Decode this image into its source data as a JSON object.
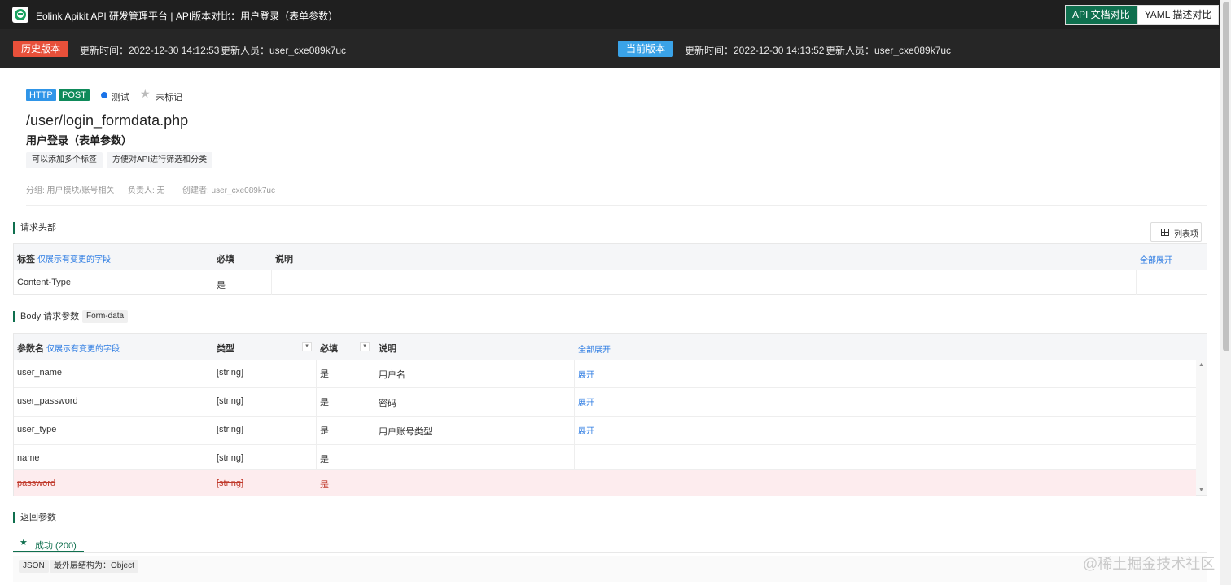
{
  "app": {
    "title": "Eolink Apikit API 研发管理平台 | API版本对比：用户登录（表单参数）",
    "compare_tabs": [
      "API 文档对比",
      "YAML 描述对比"
    ]
  },
  "versions": {
    "history": {
      "label": "历史版本",
      "time": "更新时间：2022-12-30 14:12:53",
      "user": "更新人员：user_cxe089k7uc"
    },
    "current": {
      "label": "当前版本",
      "time": "更新时间：2022-12-30 14:13:52",
      "user": "更新人员：user_cxe089k7uc"
    }
  },
  "api": {
    "protocol": "HTTP",
    "method": "POST",
    "status": "测试",
    "mark": "未标记",
    "path": "/user/login_formdata.php",
    "name": "用户登录（表单参数）",
    "tags": [
      "可以添加多个标签",
      "方便对API进行筛选和分类"
    ],
    "group": "分组: 用户模块/账号相关",
    "owner": "负责人: 无",
    "creator": "创建者: user_cxe089k7uc"
  },
  "headers_section": {
    "title": "请求头部",
    "columns_button": "列表项",
    "col_tag": "标签",
    "only_changed": "仅展示有变更的字段",
    "col_required": "必填",
    "col_desc": "说明",
    "expand_all": "全部展开",
    "rows": [
      {
        "name": "Content-Type",
        "required": "是"
      }
    ]
  },
  "body_section": {
    "title": "Body 请求参数",
    "format": "Form-data",
    "col_name": "参数名",
    "only_changed": "仅展示有变更的字段",
    "col_type": "类型",
    "col_required": "必填",
    "col_desc": "说明",
    "expand_all": "全部展开",
    "rows": [
      {
        "name": "user_name",
        "type": "[string]",
        "required": "是",
        "desc": "用户名",
        "action": "展开"
      },
      {
        "name": "user_password",
        "type": "[string]",
        "required": "是",
        "desc": "密码",
        "action": "展开"
      },
      {
        "name": "user_type",
        "type": "[string]",
        "required": "是",
        "desc": "用户账号类型",
        "action": "展开"
      },
      {
        "name": "name",
        "type": "[string]",
        "required": "是",
        "desc": "",
        "action": ""
      },
      {
        "name": "password",
        "type": "[string]",
        "required": "是",
        "desc": "",
        "action": "",
        "deleted": true
      }
    ]
  },
  "response_section": {
    "title": "返回参数",
    "tab": "成功 (200)",
    "format": "JSON",
    "structure": "最外层结构为：Object"
  },
  "watermark": "@稀土掘金技术社区",
  "colors": {
    "accent": "#0f6f4e",
    "history": "#e8503a",
    "current": "#3aa3e8",
    "link": "#2a7ae2",
    "deleted_bg": "#fdecee"
  }
}
